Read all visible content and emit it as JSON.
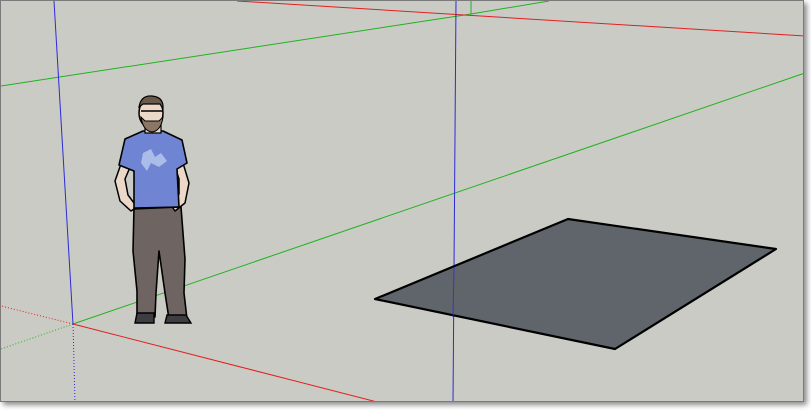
{
  "viewport": {
    "background": "#cbcbc5"
  },
  "axes": {
    "red_axis_color": "#e02020",
    "green_axis_color": "#1fb21f",
    "blue_axis_color": "#2b2bd8"
  },
  "model": {
    "rectangle_face_color": "#5f656b",
    "rectangle_edge_color": "#000000"
  },
  "scale_figure": {
    "icon": "person-figure-icon",
    "shirt_color": "#6f84d2",
    "pants_color": "#6e6462",
    "skin_color": "#ecd8c8"
  }
}
